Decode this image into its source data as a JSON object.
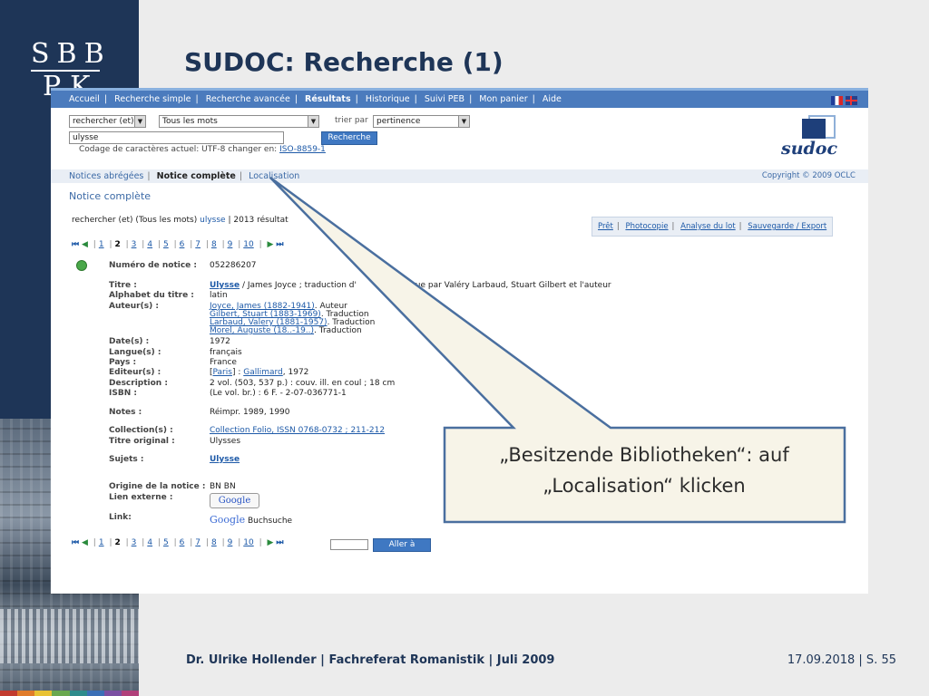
{
  "slide": {
    "logo_line1": "SBB",
    "logo_line2": "PK",
    "title": "SUDOC: Recherche (1)",
    "footer_left": "Dr. Ulrike Hollender | Fachreferat Romanistik | Juli 2009",
    "footer_right": "17.09.2018 | S. 55",
    "callout_line1": "„Besitzende Bibliotheken“: auf",
    "callout_line2": "„Localisation“ klicken",
    "colors": {
      "navy": "#1e3557",
      "callout_bg": "#f7f4e8",
      "callout_border": "#4a6f9f"
    }
  },
  "sudoc": {
    "nav": [
      "Accueil",
      "Recherche simple",
      "Recherche avancée",
      "Résultats",
      "Historique",
      "Suivi PEB",
      "Mon panier",
      "Aide"
    ],
    "active_nav": "Résultats",
    "search_mode": "rechercher (et)",
    "search_scope": "Tous les mots",
    "sort_label": "trier par",
    "sort_value": "pertinence",
    "query": "ulysse",
    "search_button": "Recherche",
    "encoding_text": "Codage de caractères actuel: UTF-8 changer en:",
    "encoding_link": "ISO-8859-1",
    "logo_word": "sudoc",
    "subnav": [
      "Notices abrégées",
      "Notice complète",
      "Localisation"
    ],
    "copyright": "Copyright © 2009 OCLC",
    "notice_title": "Notice complète",
    "summary_prefix": "rechercher (et) (Tous les mots)",
    "summary_query": "ulysse",
    "summary_suffix": "| 2013 résultat",
    "actions": [
      "Prêt",
      "Photocopie",
      "Analyse du lot",
      "Sauvegarde / Export"
    ],
    "pages": [
      "1",
      "2",
      "3",
      "4",
      "5",
      "6",
      "7",
      "8",
      "9",
      "10"
    ],
    "current_page": "2",
    "record": {
      "numero_label": "Numéro de notice :",
      "numero": "052286207",
      "titre_label": "Titre :",
      "titre_link": "Ulysse",
      "titre_rest": "/ James Joyce ; traduction d'",
      "titre_rest2": "rel revue par Valéry Larbaud, Stuart Gilbert et l'auteur",
      "alphabet_label": "Alphabet du titre :",
      "alphabet": "latin",
      "auteurs_label": "Auteur(s) :",
      "auteurs": [
        {
          "name": "Joyce, James (1882-1941)",
          "role": ". Auteur"
        },
        {
          "name": "Gilbert, Stuart (1883-1969)",
          "role": ". Traduction"
        },
        {
          "name": "Larbaud, Valery (1881-1957)",
          "role": ". Traduction"
        },
        {
          "name": "Morel, Auguste (18..-19..)",
          "role": ". Traduction"
        }
      ],
      "date_label": "Date(s) :",
      "date": "1972",
      "langue_label": "Langue(s) :",
      "langue": "français",
      "pays_label": "Pays :",
      "pays": "France",
      "editeur_label": "Editeur(s) :",
      "editeur_bracket_open": "[",
      "editeur_place": "Paris",
      "editeur_mid": "] :",
      "editeur_name": "Gallimard",
      "editeur_year": ", 1972",
      "description_label": "Description :",
      "description": "2 vol. (503, 537 p.) : couv. ill. en coul ; 18 cm",
      "isbn_label": "ISBN :",
      "isbn": "(Le vol. br.) : 6 F. - 2-07-036771-1",
      "notes_label": "Notes :",
      "notes": "Réimpr. 1989, 1990",
      "collection_label": "Collection(s) :",
      "collection": "Collection Folio, ISSN 0768-0732 ; 211-212",
      "titre_original_label": "Titre original :",
      "titre_original": "Ulysses",
      "sujets_label": "Sujets :",
      "sujets": "Ulysse",
      "origine_label": "Origine de la notice :",
      "origine": "BN BN",
      "lien_label": "Lien externe :",
      "google_button": "Google",
      "link_label": "Link:",
      "google_word": "Google",
      "buchsuche": "Buchsuche"
    },
    "goto_button": "Aller à"
  }
}
